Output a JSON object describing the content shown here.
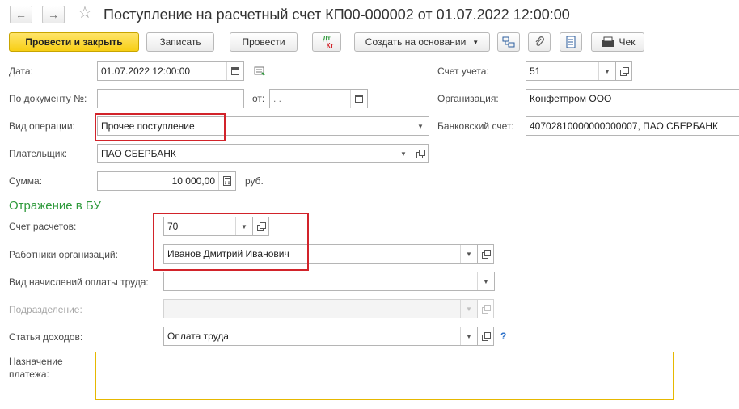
{
  "header": {
    "title": "Поступление на расчетный счет КП00-000002 от 01.07.2022 12:00:00",
    "back_icon": "arrow-left-icon",
    "forward_icon": "arrow-right-icon",
    "favorite_icon": "star-icon"
  },
  "toolbar": {
    "post_close_label": "Провести и закрыть",
    "write_label": "Записать",
    "post_label": "Провести",
    "dtkt_dt": "Дт",
    "dtkt_kt": "Кт",
    "create_based_label": "Создать на основании",
    "receipt_label": "Чек",
    "icons": [
      "structure-icon",
      "paperclip-icon",
      "report-icon",
      "receipt-icon"
    ]
  },
  "form": {
    "date": {
      "label": "Дата:",
      "value": "01.07.2022 12:00:00"
    },
    "doc_number": {
      "label": "По документу №:",
      "value": "",
      "from_label": "от:",
      "from_value": " .  ."
    },
    "operation_type": {
      "label": "Вид операции:",
      "value": "Прочее поступление"
    },
    "payer": {
      "label": "Плательщик:",
      "value": "ПАО СБЕРБАНК"
    },
    "amount": {
      "label": "Сумма:",
      "value": "10 000,00",
      "currency": "руб."
    },
    "account": {
      "label": "Счет учета:",
      "value": "51"
    },
    "organization": {
      "label": "Организация:",
      "value": "Конфетпром ООО"
    },
    "bank_account": {
      "label": "Банковский счет:",
      "value": "40702810000000000007, ПАО СБЕРБАНК"
    }
  },
  "accounting": {
    "section_title": "Отражение в БУ",
    "settlement_account": {
      "label": "Счет расчетов:",
      "value": "70"
    },
    "employees": {
      "label": "Работники организаций:",
      "value": "Иванов Дмитрий Иванович"
    },
    "payroll_type": {
      "label": "Вид начислений оплаты труда:",
      "value": ""
    },
    "department": {
      "label": "Подразделение:",
      "value": ""
    },
    "income_item": {
      "label": "Статья доходов:",
      "value": "Оплата труда",
      "help": "?"
    },
    "purpose": {
      "label_line1": "Назначение",
      "label_line2": "платежа:",
      "value": ""
    }
  },
  "colors": {
    "accent_green": "#2f9a3c",
    "highlight_red": "#d2232a",
    "primary_yellow": "#f7cf15"
  }
}
